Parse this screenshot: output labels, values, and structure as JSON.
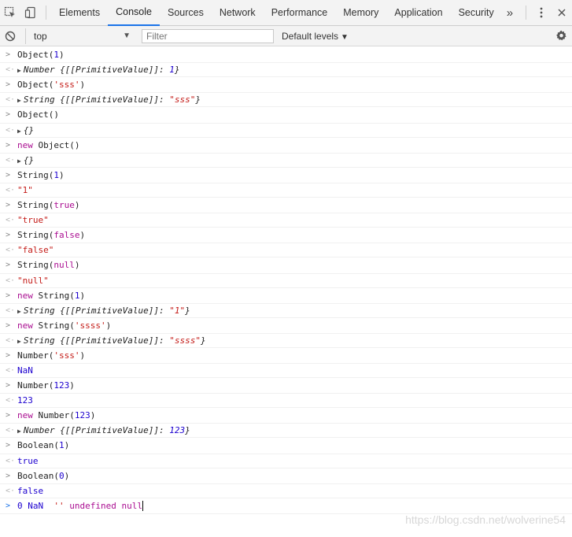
{
  "tabs": [
    {
      "label": "Elements"
    },
    {
      "label": "Console"
    },
    {
      "label": "Sources"
    },
    {
      "label": "Network"
    },
    {
      "label": "Performance"
    },
    {
      "label": "Memory"
    },
    {
      "label": "Application"
    },
    {
      "label": "Security"
    }
  ],
  "tabs_more": "»",
  "active_tab": "Console",
  "context_select": {
    "value": "top"
  },
  "filter": {
    "placeholder": "Filter",
    "value": ""
  },
  "levels": {
    "label": "Default levels"
  },
  "console_entries": [
    {
      "input": "Object(1)",
      "output": "Number {[[PrimitiveValue]]: 1}"
    },
    {
      "input": "Object('sss')",
      "output": "String {[[PrimitiveValue]]: \"sss\"}"
    },
    {
      "input": "Object()",
      "output": "{}"
    },
    {
      "input": "new Object()",
      "output": "{}"
    },
    {
      "input": "String(1)",
      "output": "\"1\""
    },
    {
      "input": "String(true)",
      "output": "\"true\""
    },
    {
      "input": "String(false)",
      "output": "\"false\""
    },
    {
      "input": "String(null)",
      "output": "\"null\""
    },
    {
      "input": "new String(1)",
      "output": "String {[[PrimitiveValue]]: \"1\"}"
    },
    {
      "input": "new String('ssss')",
      "output": "String {[[PrimitiveValue]]: \"ssss\"}"
    },
    {
      "input": "Number('sss')",
      "output": "NaN"
    },
    {
      "input": "Number(123)",
      "output": "123"
    },
    {
      "input": "new Number(123)",
      "output": "Number {[[PrimitiveValue]]: 123}"
    },
    {
      "input": "Boolean(1)",
      "output": "true"
    },
    {
      "input": "Boolean(0)",
      "output": "false"
    }
  ],
  "prompt": {
    "text": "0 NaN  '' undefined null"
  },
  "watermark": "https://blog.csdn.net/wolverine54",
  "colors": {
    "keyword": "#aa0d91",
    "string": "#c41a16",
    "number": "#1c00cf",
    "active_tab_underline": "#1a73e8"
  },
  "icons": [
    "inspect-element-icon",
    "device-toolbar-icon",
    "clear-console-icon",
    "more-options-icon",
    "close-icon",
    "settings-gear-icon",
    "expand-triangle-icon"
  ]
}
